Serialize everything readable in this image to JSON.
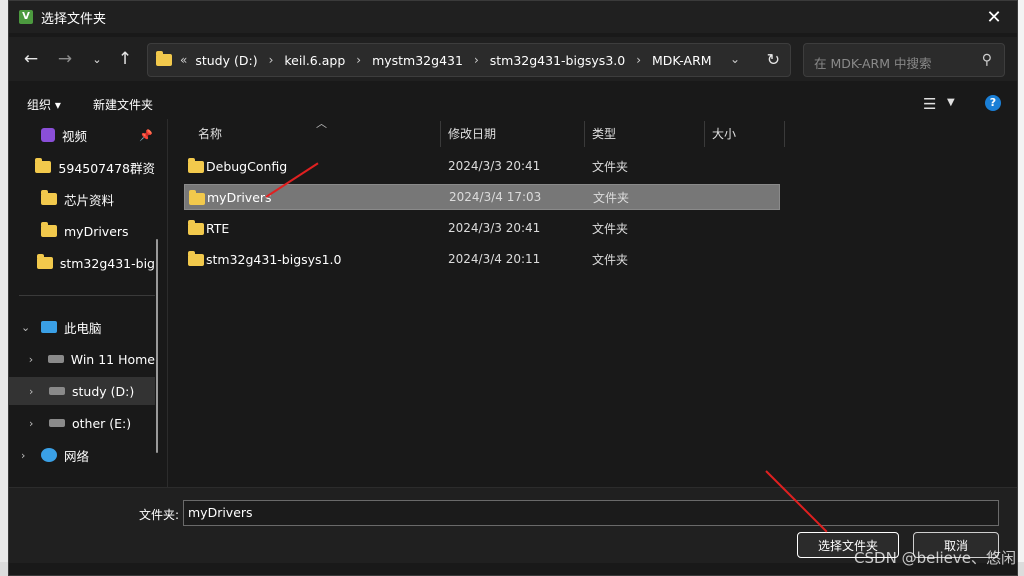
{
  "window": {
    "title": "选择文件夹",
    "app_icon": "V"
  },
  "nav": {
    "breadcrumb_more": "«",
    "breadcrumbs": [
      "study (D:)",
      "keil.6.app",
      "mystm32g431",
      "stm32g431-bigsys3.0",
      "MDK-ARM"
    ],
    "search_placeholder": "在 MDK-ARM 中搜索"
  },
  "toolbar": {
    "organize_label": "组织 ▾",
    "new_folder_label": "新建文件夹"
  },
  "sidebar": {
    "quick": [
      {
        "label": "视频",
        "icon": "video-icon",
        "pinned": true
      },
      {
        "label": "594507478群资"
      },
      {
        "label": "芯片资料"
      },
      {
        "label": "myDrivers"
      },
      {
        "label": "stm32g431-big"
      }
    ],
    "tree": [
      {
        "label": "此电脑",
        "expanded": true,
        "icon": "pc-icon"
      },
      {
        "label": "Win 11 Home",
        "icon": "drive-icon"
      },
      {
        "label": "study (D:)",
        "icon": "drive-icon",
        "selected": true
      },
      {
        "label": "other (E:)",
        "icon": "drive-icon"
      },
      {
        "label": "网络",
        "icon": "network-icon"
      }
    ]
  },
  "columns": {
    "name": "名称",
    "date": "修改日期",
    "type": "类型",
    "size": "大小"
  },
  "files": [
    {
      "name": "DebugConfig",
      "date": "2024/3/3 20:41",
      "type": "文件夹",
      "selected": false
    },
    {
      "name": "myDrivers",
      "date": "2024/3/4 17:03",
      "type": "文件夹",
      "selected": true
    },
    {
      "name": "RTE",
      "date": "2024/3/3 20:41",
      "type": "文件夹",
      "selected": false
    },
    {
      "name": "stm32g431-bigsys1.0",
      "date": "2024/3/4 20:11",
      "type": "文件夹",
      "selected": false
    }
  ],
  "footer": {
    "folder_label": "文件夹:",
    "folder_value": "myDrivers",
    "select_button": "选择文件夹",
    "cancel_button": "取消"
  },
  "watermark": "CSDN @believe、悠闲",
  "colors": {
    "dialog_bg": "#191919",
    "selected_row": "#777777",
    "folder": "#f2c94c",
    "annotation_arrow": "#e02020",
    "help_blue": "#1a7fd6"
  }
}
